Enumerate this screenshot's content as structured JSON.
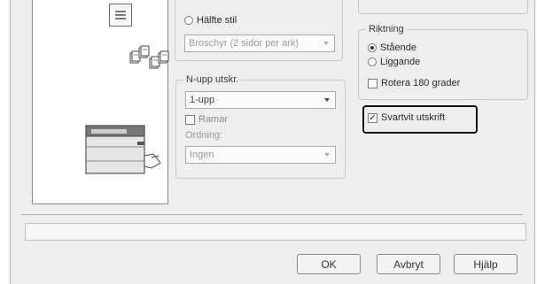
{
  "layout_group": {
    "half_style_label": "Hälfte stil",
    "booklet_select_value": "Broschyr (2 sidor per ark)"
  },
  "n_up": {
    "group_label": "N-upp utskr.",
    "select_value": "1-upp",
    "borders_label": "Ramar",
    "order_label": "Ordning:",
    "order_value": "Ingen"
  },
  "orientation": {
    "group_label": "Riktning",
    "portrait_label": "Stående",
    "landscape_label": "Liggande",
    "rotate_label": "Rotera 180 grader"
  },
  "bw_print_label": "Svartvit utskrift",
  "buttons": {
    "ok": "OK",
    "cancel": "Avbryt",
    "help": "Hjälp"
  }
}
